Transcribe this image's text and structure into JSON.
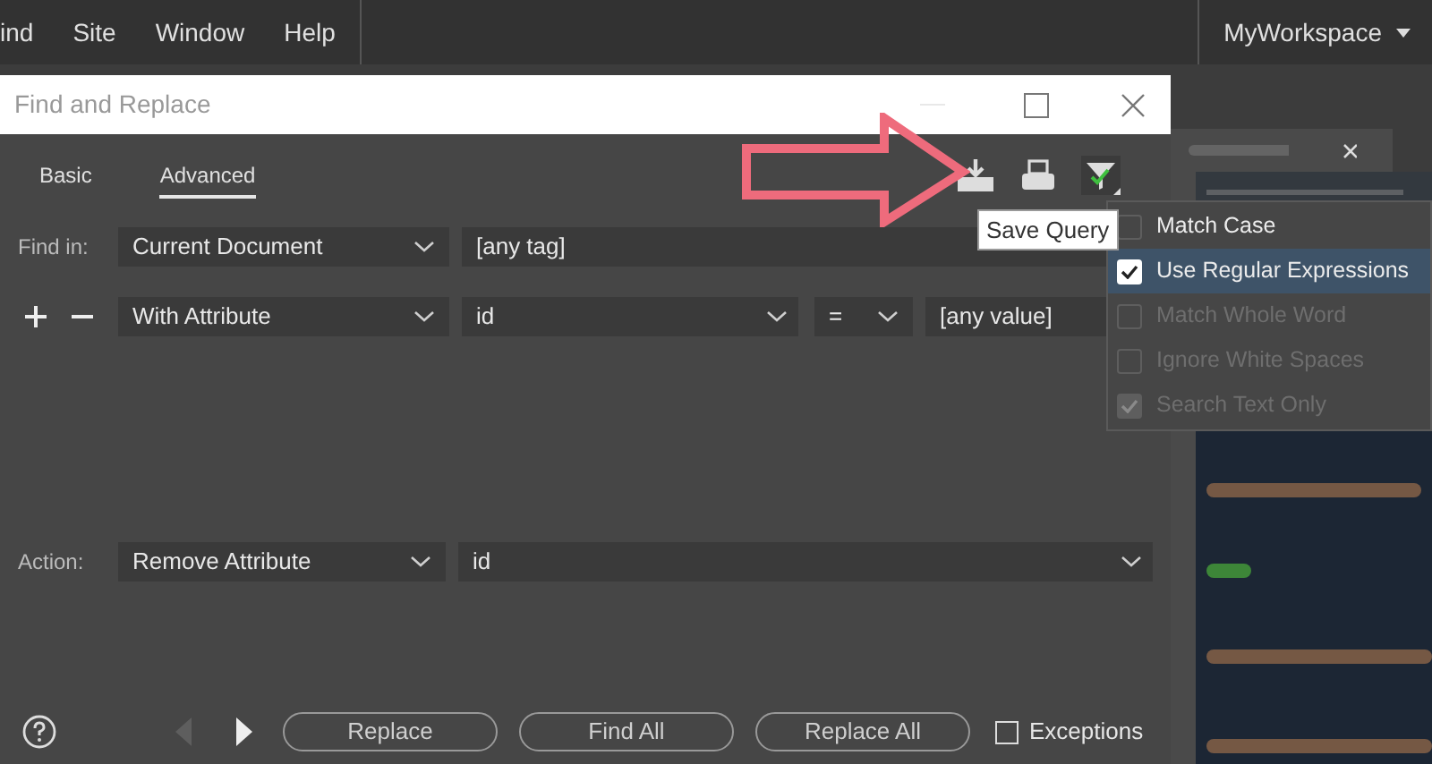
{
  "menubar": {
    "items": [
      "ind",
      "Site",
      "Window",
      "Help"
    ],
    "workspace": "MyWorkspace"
  },
  "dialog": {
    "title": "Find and Replace",
    "tabs": [
      {
        "label": "Basic",
        "selected": false
      },
      {
        "label": "Advanced",
        "selected": true
      }
    ],
    "find_in": {
      "label": "Find in:",
      "scope": "Current Document",
      "tag": "[any tag]"
    },
    "condition": {
      "scope": "With Attribute",
      "attribute": "id",
      "operator": "=",
      "value": "[any value]"
    },
    "action": {
      "label": "Action:",
      "type": "Remove Attribute",
      "attribute": "id"
    },
    "nav": [
      {
        "kind": "prev",
        "disabled": true
      },
      {
        "kind": "next",
        "disabled": false
      }
    ],
    "buttons": [
      "Replace",
      "Find All",
      "Replace All"
    ],
    "exceptions": {
      "label": "Exceptions",
      "checked": false
    }
  },
  "tooltip": "Save Query",
  "options_menu": [
    {
      "label": "Match Case",
      "checked": false,
      "disabled": false,
      "selected": false
    },
    {
      "label": "Use Regular Expressions",
      "checked": true,
      "disabled": false,
      "selected": true
    },
    {
      "label": "Match Whole Word",
      "checked": false,
      "disabled": true,
      "selected": false
    },
    {
      "label": "Ignore White Spaces",
      "checked": false,
      "disabled": true,
      "selected": false
    },
    {
      "label": "Search Text Only",
      "checked": true,
      "disabled": true,
      "selected": false
    }
  ]
}
